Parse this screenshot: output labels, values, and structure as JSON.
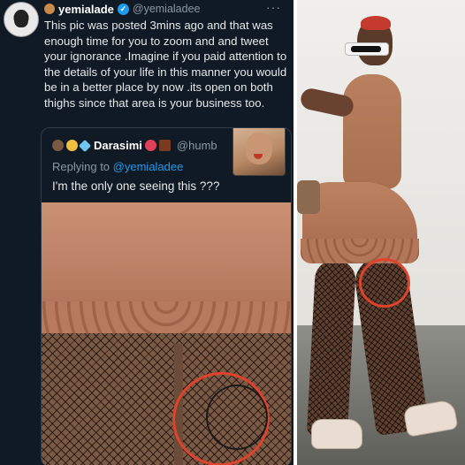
{
  "tweet": {
    "display_name": "yemialade",
    "handle": "@yemialadee",
    "more": "···",
    "text": "This pic was posted 3mins ago and that was enough time for you to zoom and and tweet your ignorance .Imagine if you paid attention to the details of your life in this manner you would be in a better place by now .its open on both thighs since that area is your business too."
  },
  "quote": {
    "display_name": "Darasimi",
    "handle": "@humb",
    "replying_prefix": "Replying to",
    "replying_mention": "@yemialadee",
    "text": "I'm the only one seeing this ???"
  },
  "colors": {
    "background": "#0f1a24",
    "verified": "#1d9bf0",
    "annotation_circle": "#e0432b"
  }
}
